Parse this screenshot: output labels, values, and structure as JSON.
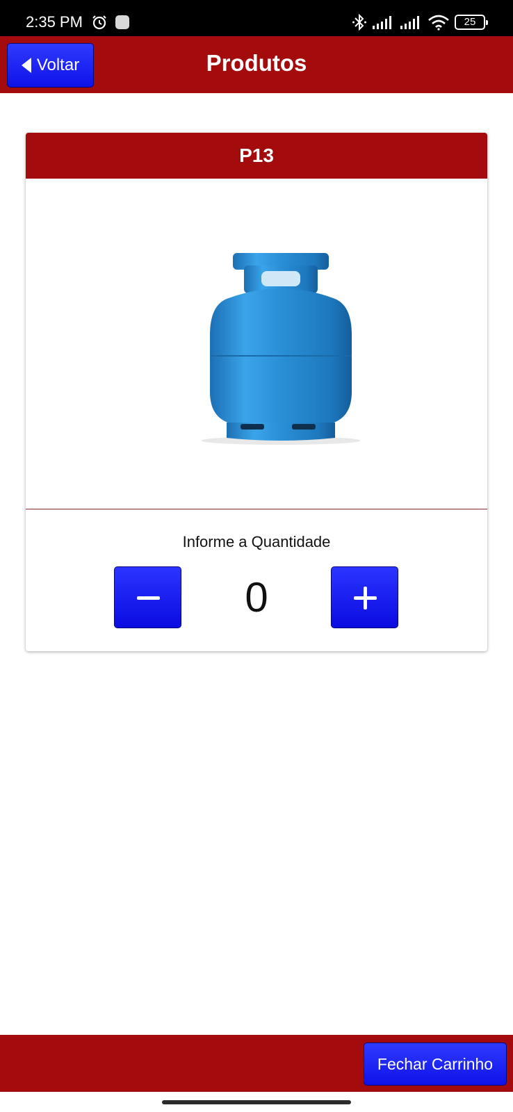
{
  "status_bar": {
    "time": "2:35 PM",
    "battery": "25",
    "icons": [
      "alarm-icon",
      "notification-icon",
      "bluetooth-icon",
      "signal-icon",
      "signal-icon",
      "wifi-icon",
      "battery-icon"
    ]
  },
  "header": {
    "back_label": "Voltar",
    "title": "Produtos"
  },
  "product": {
    "name": "P13",
    "image_icon": "gas-cylinder-image",
    "quantity_label": "Informe a Quantidade",
    "quantity": "0"
  },
  "footer": {
    "checkout_label": "Fechar Carrinho"
  },
  "colors": {
    "header_red": "#a30b0c",
    "button_blue": "#1a1fff",
    "cylinder_blue": "#2a8fd6"
  }
}
